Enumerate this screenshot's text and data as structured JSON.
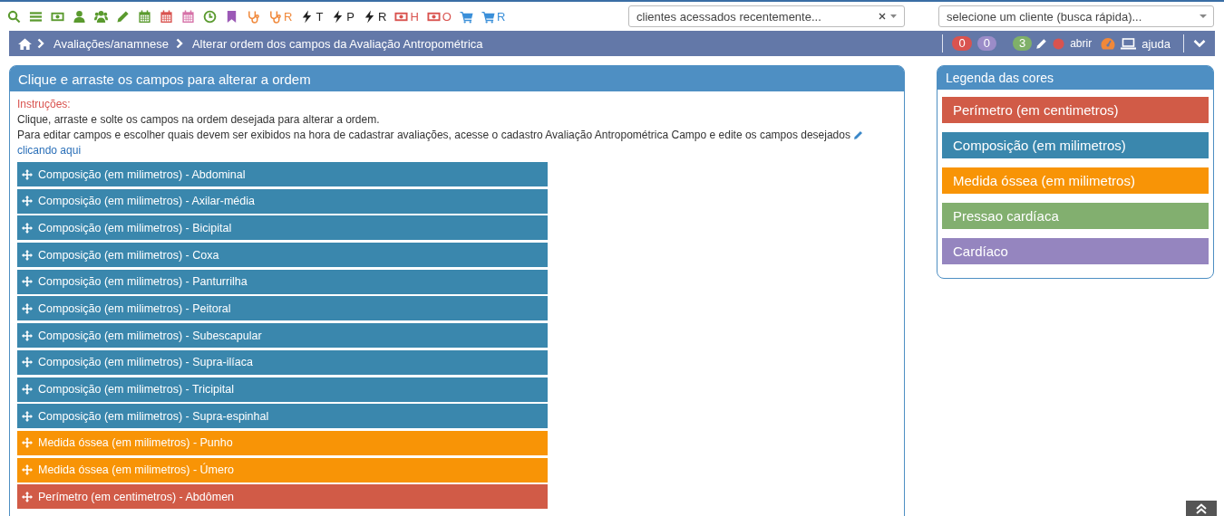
{
  "toolbar": [
    {
      "kind": "search",
      "color": "#5a9a2e"
    },
    {
      "kind": "menu",
      "color": "#5a9a2e"
    },
    {
      "kind": "money",
      "color": "#5a9a2e"
    },
    {
      "kind": "user",
      "color": "#5a9a2e"
    },
    {
      "kind": "users",
      "color": "#5a9a2e"
    },
    {
      "kind": "pencil",
      "color": "#5a9a2e"
    },
    {
      "kind": "calendar",
      "color": "#5a9a2e"
    },
    {
      "kind": "calendar",
      "color": "#d9534f"
    },
    {
      "kind": "calendar",
      "color": "#d672a8"
    },
    {
      "kind": "clock",
      "color": "#5a9a2e"
    },
    {
      "kind": "bookmark",
      "color": "#9b59b6"
    },
    {
      "kind": "stethoscope",
      "color": "#f0883a"
    },
    {
      "kind": "stethoscope",
      "color": "#f0883a",
      "letter": "R"
    },
    {
      "kind": "bolt",
      "color": "#222222",
      "letter": "T"
    },
    {
      "kind": "bolt",
      "color": "#222222",
      "letter": "P"
    },
    {
      "kind": "bolt",
      "color": "#222222",
      "letter": "R"
    },
    {
      "kind": "money",
      "color": "#d9534f",
      "letter": "H"
    },
    {
      "kind": "money",
      "color": "#d9534f",
      "letter": "O"
    },
    {
      "kind": "cart",
      "color": "#3a8fd9"
    },
    {
      "kind": "cart",
      "color": "#3a8fd9",
      "letter": "R"
    }
  ],
  "recent_clients": {
    "placeholder": "clientes acessados recentemente..."
  },
  "quick_search": {
    "placeholder": "selecione um cliente (busca rápida)..."
  },
  "breadcrumb": [
    "Avaliações/anamnese",
    "Alterar ordem dos campos da Avaliação Antropométrica"
  ],
  "badges": [
    {
      "text": "0",
      "color": "#d9534f"
    },
    {
      "text": "0",
      "color": "#9b8cc8"
    },
    {
      "text": "3",
      "color": "#7fb069"
    }
  ],
  "open_label": "abrir",
  "help_label": "ajuda",
  "panel": {
    "title": "Clique e arraste os campos para alterar a ordem",
    "instructions_label": "Instruções:",
    "line_1": "Clique, arraste e solte os campos na ordem desejada para alterar a ordem.",
    "line_2": "Para editar campos e escolher quais devem ser exibidos na hora de cadastrar avaliações, acesse o cadastro Avaliação Antropométrica Campo e edite os campos desejados",
    "link": "clicando aqui"
  },
  "fields": [
    {
      "label": "Composição (em milimetros) - Abdominal",
      "color": "#3a87ad"
    },
    {
      "label": "Composição (em milimetros) - Axilar-média",
      "color": "#3a87ad"
    },
    {
      "label": "Composição (em milimetros) - Bicipital",
      "color": "#3a87ad"
    },
    {
      "label": "Composição (em milimetros) - Coxa",
      "color": "#3a87ad"
    },
    {
      "label": "Composição (em milimetros) - Panturrilha",
      "color": "#3a87ad"
    },
    {
      "label": "Composição (em milimetros) - Peitoral",
      "color": "#3a87ad"
    },
    {
      "label": "Composição (em milimetros) - Subescapular",
      "color": "#3a87ad"
    },
    {
      "label": "Composição (em milimetros) - Supra-ilíaca",
      "color": "#3a87ad"
    },
    {
      "label": "Composição (em milimetros) - Tricipital",
      "color": "#3a87ad"
    },
    {
      "label": "Composição (em milimetros) - Supra-espinhal",
      "color": "#3a87ad"
    },
    {
      "label": "Medida óssea (em milimetros) - Punho",
      "color": "#f89406"
    },
    {
      "label": "Medida óssea (em milimetros) - Úmero",
      "color": "#f89406"
    },
    {
      "label": "Perímetro (em centimetros) - Abdômen",
      "color": "#d15b47"
    }
  ],
  "legend": {
    "title": "Legenda das cores",
    "items": [
      {
        "label": "Perímetro (em centimetros)",
        "color": "#d15b47"
      },
      {
        "label": "Composição (em milimetros)",
        "color": "#3a87ad"
      },
      {
        "label": "Medida óssea (em milimetros)",
        "color": "#f89406"
      },
      {
        "label": "Pressao cardíaca",
        "color": "#82af6f"
      },
      {
        "label": "Cardíaco",
        "color": "#9585bf"
      }
    ]
  }
}
